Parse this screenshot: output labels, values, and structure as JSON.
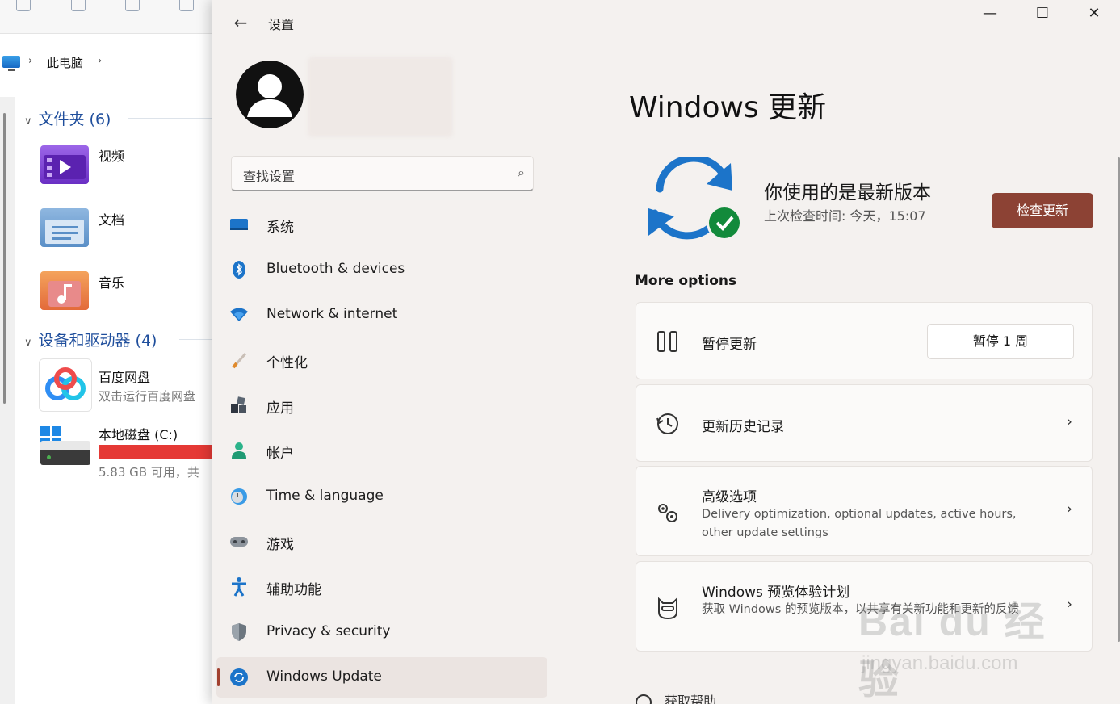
{
  "explorer": {
    "breadcrumb": "此电脑",
    "folders_group": "文件夹 (6)",
    "folders": [
      {
        "label": "视频",
        "color": "#7e3fd6"
      },
      {
        "label": "文档",
        "color": "#5a8fc7"
      },
      {
        "label": "音乐",
        "color": "#e36a3a"
      }
    ],
    "devices_group": "设备和驱动器 (4)",
    "baidu": {
      "name": "百度网盘",
      "sub": "双击运行百度网盘"
    },
    "drive": {
      "name": "本地磁盘 (C:)",
      "sub": "5.83 GB 可用，共",
      "usage_fraction": 0.97
    }
  },
  "settings": {
    "app_title": "设置",
    "search_placeholder": "查找设置",
    "nav": [
      {
        "label": "系统",
        "icon": "monitor-icon"
      },
      {
        "label": "Bluetooth & devices",
        "icon": "bluetooth-icon"
      },
      {
        "label": "Network & internet",
        "icon": "wifi-icon"
      },
      {
        "label": "个性化",
        "icon": "brush-icon"
      },
      {
        "label": "应用",
        "icon": "apps-icon"
      },
      {
        "label": "帐户",
        "icon": "person-icon"
      },
      {
        "label": "Time & language",
        "icon": "globe-clock-icon"
      },
      {
        "label": "游戏",
        "icon": "gamepad-icon"
      },
      {
        "label": "辅助功能",
        "icon": "accessibility-icon"
      },
      {
        "label": "Privacy & security",
        "icon": "shield-icon"
      },
      {
        "label": "Windows Update",
        "icon": "update-icon",
        "active": true
      }
    ],
    "page_title": "Windows 更新",
    "status_title": "你使用的是最新版本",
    "status_sub": "上次检查时间: 今天，15:07",
    "check_button": "检查更新",
    "more_options": "More options",
    "cards": {
      "pause": {
        "title": "暂停更新",
        "button": "暂停 1 周"
      },
      "history": {
        "title": "更新历史记录"
      },
      "advanced": {
        "title": "高级选项",
        "desc": "Delivery optimization, optional updates, active hours, other update settings"
      },
      "insider": {
        "title": "Windows 预览体验计划",
        "desc": "获取 Windows 的预览版本，以共享有关新功能和更新的反馈"
      }
    },
    "help": "获取帮助",
    "accent": "#8c4234"
  },
  "watermark": {
    "line1": "Bai du 经验",
    "line2": "jingyan.baidu.com"
  }
}
